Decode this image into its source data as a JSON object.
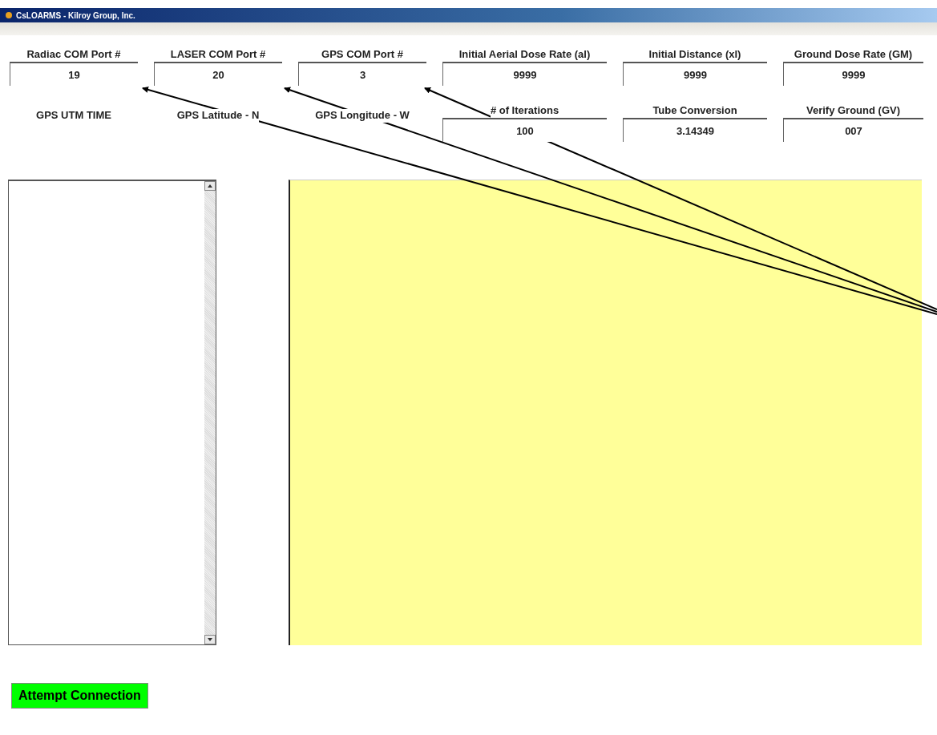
{
  "window": {
    "title": "CsLOARMS - Kilroy Group, Inc."
  },
  "settings": [
    {
      "kind": "field",
      "label": "Radiac COM Port #",
      "value": "19"
    },
    {
      "kind": "field",
      "label": "LASER COM Port #",
      "value": "20"
    },
    {
      "kind": "field",
      "label": "GPS COM Port #",
      "value": "3"
    },
    {
      "kind": "field",
      "label": "Initial Aerial Dose Rate (al)",
      "value": "9999"
    },
    {
      "kind": "field",
      "label": "Initial Distance (xl)",
      "value": "9999"
    },
    {
      "kind": "field",
      "label": "Ground Dose Rate (GM)",
      "value": "9999"
    },
    {
      "kind": "label",
      "label": "GPS UTM TIME"
    },
    {
      "kind": "label",
      "label": "GPS Latitude - N"
    },
    {
      "kind": "label",
      "label": "GPS Longitude - W"
    },
    {
      "kind": "field",
      "label": "# of Iterations",
      "value": "100"
    },
    {
      "kind": "field",
      "label": "Tube Conversion",
      "value": "3.14349"
    },
    {
      "kind": "field",
      "label": "Verify Ground (GV)",
      "value": "007"
    }
  ],
  "connect_button": {
    "label": "Attempt Connection"
  }
}
